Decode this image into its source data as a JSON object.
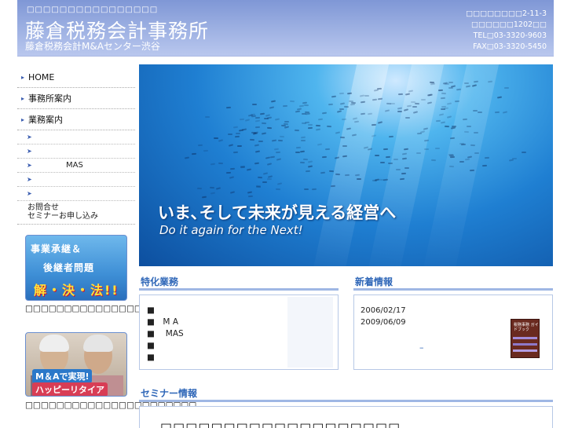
{
  "header": {
    "tagline": "□□□□□□□□□□□□□□□□",
    "logo": "藤倉税務会計事務所",
    "sub": "藤倉税務会計M&Aセンター渋谷",
    "addr1": "□□□□□□□□2-11-3",
    "addr2": "□□□□□□1202□□",
    "tel": "TEL□03-3320-9603",
    "fax": "FAX□03-3320-5450"
  },
  "nav": {
    "home": "HOME",
    "office": "事務所案内",
    "services": "業務案内",
    "sub_items": [
      "",
      "",
      "MAS",
      "",
      ""
    ],
    "contact1": "お問合せ",
    "contact2": "セミナーお申し込み"
  },
  "banners": {
    "b1_l1": "事業承継＆",
    "b1_l2": "後継者問題",
    "b1_l3": "解・決・法!!",
    "b1_caption": "□□□□□□□□□□□□□□□□□□□□□□□□□□□□□□",
    "b2_l1": "M＆Aで実現!",
    "b2_l2": "ハッピーリタイア",
    "b2_caption": "□□□□□□□□□□□□□□□□□□□□□□"
  },
  "hero": {
    "jp": "いま､そして未来が見える経営へ",
    "en": "Do it again for the Next!"
  },
  "specialty": {
    "heading": "特化業務",
    "items": [
      "■",
      "■　M A",
      "■　 MAS",
      "■",
      "■"
    ]
  },
  "news": {
    "heading": "新着情報",
    "dates": [
      "2006/02/17",
      "2009/06/09"
    ],
    "dash": "–",
    "book_title": "税務事務\nガイドブック"
  },
  "seminar": {
    "heading": "セミナー情報",
    "text": "□□□□□□□□□□□□□□□□□□□"
  }
}
